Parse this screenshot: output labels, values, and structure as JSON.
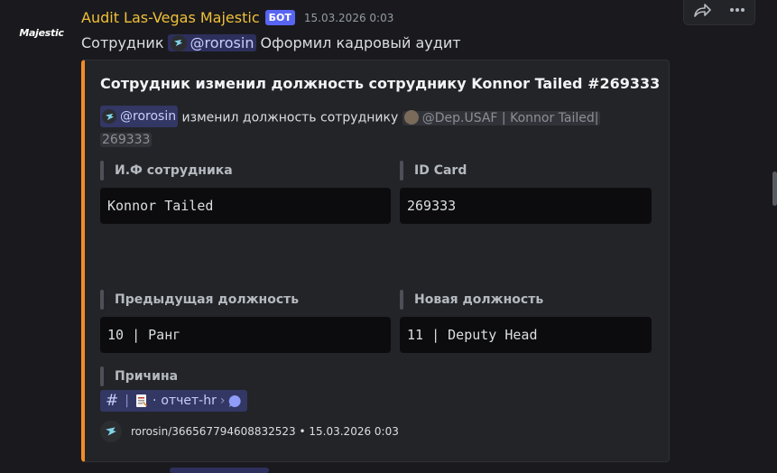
{
  "message": {
    "avatar_text": "Majestic",
    "author": "Audit Las-Vegas Majestic",
    "bot_tag": "БОТ",
    "timestamp": "15.03.2026 0:03",
    "content_prefix": "Сотрудник",
    "content_mention": "@rorosin",
    "content_suffix": "Оформил кадровый аудит"
  },
  "embed": {
    "accent_color": "#f28c28",
    "title": "Сотрудник изменил должность сотруднику Konnor Tailed #269333",
    "desc_mention": "@rorosin",
    "desc_text": "изменил должность сотруднику",
    "desc_target": "@Dep.USAF | Konnor Tailed|",
    "desc_target_id": "269333",
    "fields": [
      {
        "name": "И.Ф сотрудника",
        "value": "Konnor Tailed"
      },
      {
        "name": "ID Card",
        "value": "269333"
      },
      {
        "name": "Предыдущая должность",
        "value": "10 | Ранг"
      },
      {
        "name": "Новая должность",
        "value": "11 | Deputy Head"
      },
      {
        "name": "Причина"
      }
    ],
    "channel": {
      "hash": "#",
      "sep": "|",
      "dot": "·",
      "name": "отчет-hr",
      "chevron": "›"
    },
    "footer": "rorosin/366567794608832523 • 15.03.2026 0:03"
  },
  "icons": {
    "share": "share-icon",
    "more": "more-icon"
  }
}
